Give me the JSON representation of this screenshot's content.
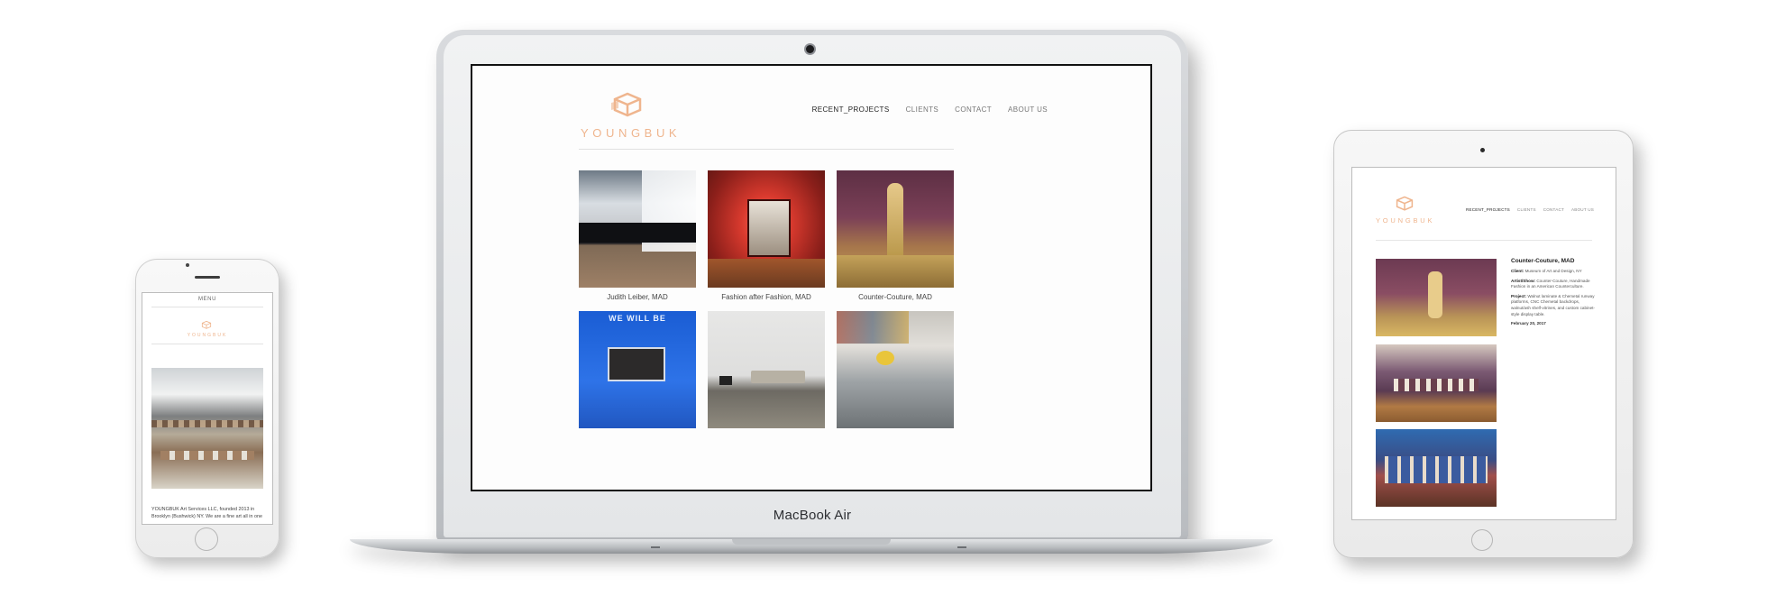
{
  "laptop": {
    "brand": "MacBook Air",
    "site": {
      "logo_text": "YOUNGBUK",
      "nav": [
        {
          "label": "RECENT_PROJECTS",
          "active": true
        },
        {
          "label": "CLIENTS",
          "active": false
        },
        {
          "label": "CONTACT",
          "active": false
        },
        {
          "label": "ABOUT US",
          "active": false
        }
      ],
      "projects": [
        {
          "caption": "Judith Leiber, MAD"
        },
        {
          "caption": "Fashion after Fashion, MAD"
        },
        {
          "caption": "Counter-Couture, MAD"
        },
        {
          "caption": "",
          "sign_text": "WE WILL BE"
        },
        {
          "caption": ""
        },
        {
          "caption": ""
        }
      ]
    }
  },
  "phone": {
    "menu_label": "MENU",
    "logo_text": "YOUNGBUK",
    "body_text": "YOUNGBUK Art Services LLC, founded 2013 in Brooklyn (Bushwick) NY. We are a fine art all in one"
  },
  "tablet": {
    "logo_text": "YOUNGBUK",
    "nav": [
      {
        "label": "RECENT_PROJECTS",
        "active": true
      },
      {
        "label": "CLIENTS",
        "active": false
      },
      {
        "label": "CONTACT",
        "active": false
      },
      {
        "label": "ABOUT US",
        "active": false
      }
    ],
    "detail": {
      "title": "Counter-Couture, MAD",
      "client_label": "Client:",
      "client_value": "Museum of Art and Design, NY",
      "artist_label": "Artist/Show:",
      "artist_value": "Counter-Couture, Handmade Fashion in an American Counterculture.",
      "project_label": "Project:",
      "project_value": "Walnut laminate & Chemetal runway platforms, CNC Chemetal backdrops, walnut/ash shelf-vitrines, and custom cabinet-style display table.",
      "date": "February 20, 2017"
    }
  },
  "colors": {
    "logo_peach": "#efb58e",
    "laptop_silver": "#c5c8cc",
    "screen_bg": "#fdfdfd"
  }
}
